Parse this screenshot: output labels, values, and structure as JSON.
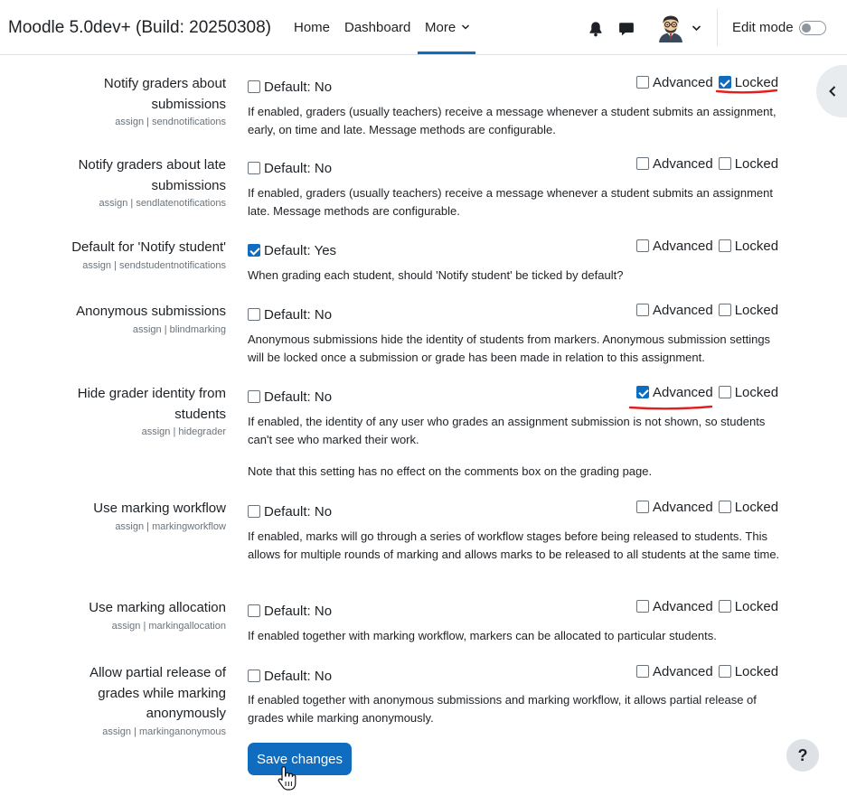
{
  "header": {
    "site_name": "Moodle 5.0dev+ (Build: 20250308)",
    "nav": {
      "home": "Home",
      "dashboard": "Dashboard",
      "more": "More"
    },
    "edit_mode_label": "Edit mode",
    "edit_mode_on": false
  },
  "common": {
    "advanced_label": "Advanced",
    "locked_label": "Locked"
  },
  "settings": [
    {
      "label_lines": [
        "Notify graders about",
        "submissions"
      ],
      "key": "assign | sendnotifications",
      "default_label": "Default: No",
      "default_checked": false,
      "advanced": false,
      "locked": true,
      "description": [
        "If enabled, graders (usually teachers) receive a message whenever a student submits an assignment, early, on time and late. Message methods are configurable."
      ]
    },
    {
      "label_lines": [
        "Notify graders about late",
        "submissions"
      ],
      "key": "assign | sendlatenotifications",
      "default_label": "Default: No",
      "default_checked": false,
      "advanced": false,
      "locked": false,
      "description": [
        "If enabled, graders (usually teachers) receive a message whenever a student submits an assignment late. Message methods are configurable."
      ]
    },
    {
      "label_lines": [
        "Default for 'Notify student'"
      ],
      "key": "assign | sendstudentnotifications",
      "default_label": "Default: Yes",
      "default_checked": true,
      "advanced": false,
      "locked": false,
      "description": [
        "When grading each student, should 'Notify student' be ticked by default?"
      ]
    },
    {
      "label_lines": [
        "Anonymous submissions"
      ],
      "key": "assign | blindmarking",
      "default_label": "Default: No",
      "default_checked": false,
      "advanced": false,
      "locked": false,
      "description": [
        "Anonymous submissions hide the identity of students from markers. Anonymous submission settings will be locked once a submission or grade has been made in relation to this assignment."
      ]
    },
    {
      "label_lines": [
        "Hide grader identity from",
        "students"
      ],
      "key": "assign | hidegrader",
      "default_label": "Default: No",
      "default_checked": false,
      "advanced": true,
      "locked": false,
      "description": [
        "If enabled, the identity of any user who grades an assignment submission is not shown, so students can't see who marked their work.",
        "Note that this setting has no effect on the comments box on the grading page."
      ]
    },
    {
      "label_lines": [
        "Use marking workflow"
      ],
      "key": "assign | markingworkflow",
      "default_label": "Default: No",
      "default_checked": false,
      "advanced": false,
      "locked": false,
      "description": [
        "If enabled, marks will go through a series of workflow stages before being released to students. This allows for multiple rounds of marking and allows marks to be released to all students at the same time."
      ]
    },
    {
      "label_lines": [
        "Use marking allocation"
      ],
      "key": "assign | markingallocation",
      "default_label": "Default: No",
      "default_checked": false,
      "advanced": false,
      "locked": false,
      "description": [
        "If enabled together with marking workflow, markers can be allocated to particular students."
      ]
    },
    {
      "label_lines": [
        "Allow partial release of",
        "grades while marking",
        "anonymously"
      ],
      "key": "assign | markinganonymous",
      "default_label": "Default: No",
      "default_checked": false,
      "advanced": false,
      "locked": false,
      "description": [
        "If enabled together with anonymous submissions and marking workflow, it allows partial release of grades while marking anonymously."
      ]
    }
  ],
  "footer": {
    "save_label": "Save changes",
    "help_label": "?"
  },
  "colors": {
    "accent": "#0f6cbf",
    "annotation": "#e02020"
  }
}
